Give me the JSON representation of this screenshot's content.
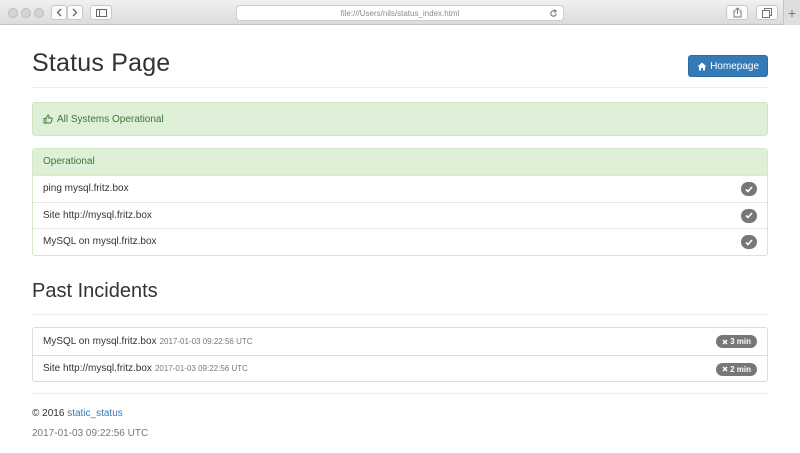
{
  "browser": {
    "url": "file:///Users/nils/status_index.html"
  },
  "header": {
    "title": "Status Page",
    "home_button_label": "Homepage"
  },
  "alert": {
    "text": "All Systems Operational"
  },
  "operational_panel": {
    "heading": "Operational",
    "services": [
      {
        "name": "ping mysql.fritz.box"
      },
      {
        "name": "Site http://mysql.fritz.box"
      },
      {
        "name": "MySQL on mysql.fritz.box"
      }
    ]
  },
  "past_incidents": {
    "title": "Past Incidents",
    "items": [
      {
        "name": "MySQL on mysql.fritz.box",
        "time": "2017-01-03 09:22:56 UTC",
        "duration": "3 min"
      },
      {
        "name": "Site http://mysql.fritz.box",
        "time": "2017-01-03 09:22:56 UTC",
        "duration": "2 min"
      }
    ]
  },
  "footer": {
    "copyright": "© 2016",
    "link_text": "static_status",
    "timestamp": "2017-01-03 09:22:56 UTC"
  },
  "colors": {
    "primary": "#337ab7",
    "success_bg": "#dff0d8",
    "success_text": "#3c763d",
    "badge_gray": "#777777"
  }
}
